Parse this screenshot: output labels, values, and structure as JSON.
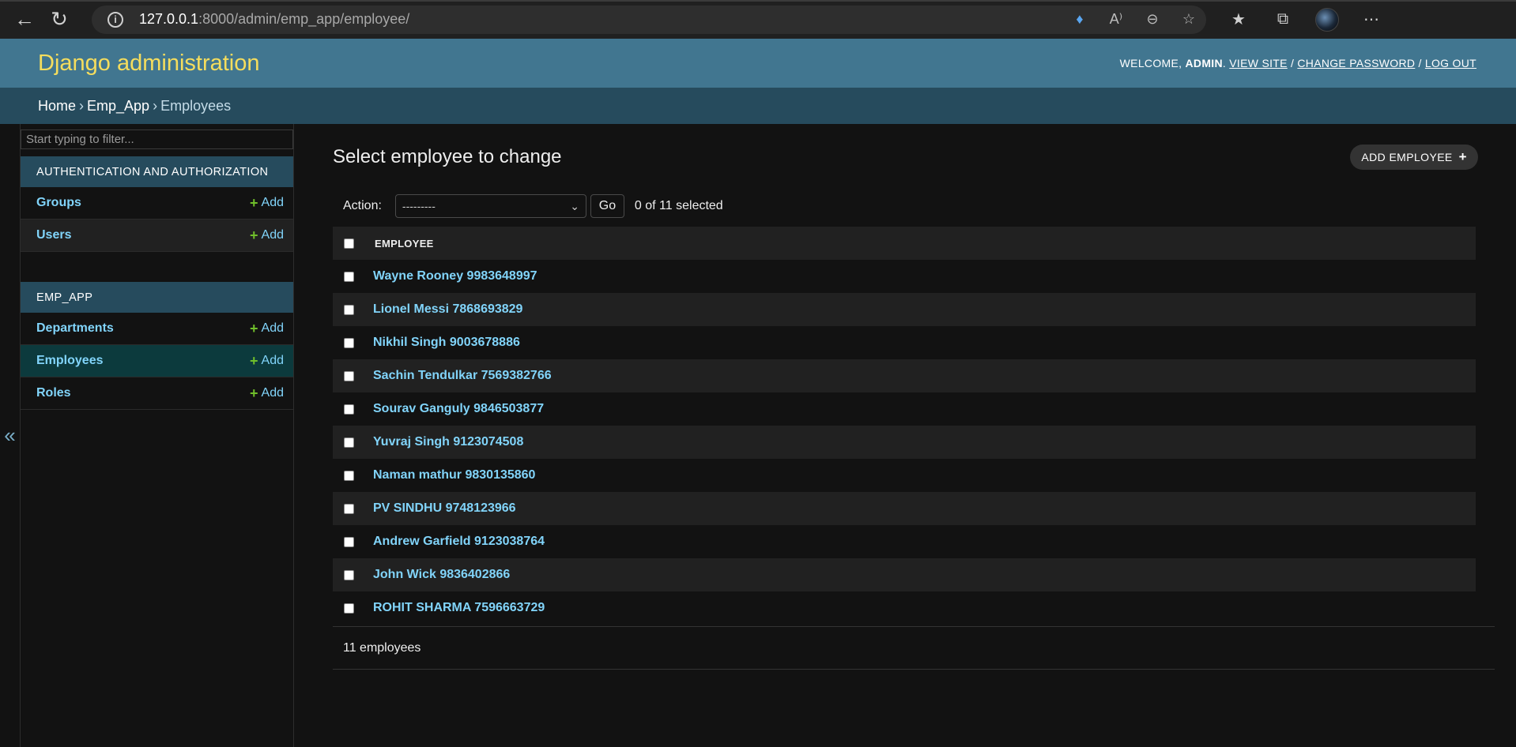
{
  "browser": {
    "url_host": "127.0.0.1",
    "url_rest": ":8000/admin/emp_app/employee/"
  },
  "header": {
    "branding": "Django administration",
    "welcome": "WELCOME,",
    "user": "ADMIN",
    "view_site": "VIEW SITE",
    "change_password": "CHANGE PASSWORD",
    "log_out": "LOG OUT"
  },
  "breadcrumbs": {
    "home": "Home",
    "app": "Emp_App",
    "current": "Employees"
  },
  "sidebar": {
    "filter_placeholder": "Start typing to filter...",
    "apps": [
      {
        "caption": "AUTHENTICATION AND AUTHORIZATION",
        "models": [
          {
            "name": "Groups",
            "add": "Add"
          },
          {
            "name": "Users",
            "add": "Add"
          }
        ]
      },
      {
        "caption": "EMP_APP",
        "models": [
          {
            "name": "Departments",
            "add": "Add"
          },
          {
            "name": "Employees",
            "add": "Add"
          },
          {
            "name": "Roles",
            "add": "Add"
          }
        ]
      }
    ]
  },
  "content": {
    "title": "Select employee to change",
    "add_button": "ADD EMPLOYEE",
    "action_label": "Action:",
    "action_selected": "---------",
    "go": "Go",
    "selection_count": "0 of 11 selected",
    "column_header": "EMPLOYEE",
    "rows": [
      "Wayne Rooney 9983648997",
      "Lionel Messi 7868693829",
      "Nikhil Singh 9003678886",
      "Sachin Tendulkar 7569382766",
      "Sourav Ganguly 9846503877",
      "Yuvraj Singh 9123074508",
      "Naman mathur 9830135860",
      "PV SINDHU 9748123966",
      "Andrew Garfield 9123038764",
      "John Wick 9836402866",
      "ROHIT SHARMA 7596663729"
    ],
    "paginator": "11 employees"
  }
}
